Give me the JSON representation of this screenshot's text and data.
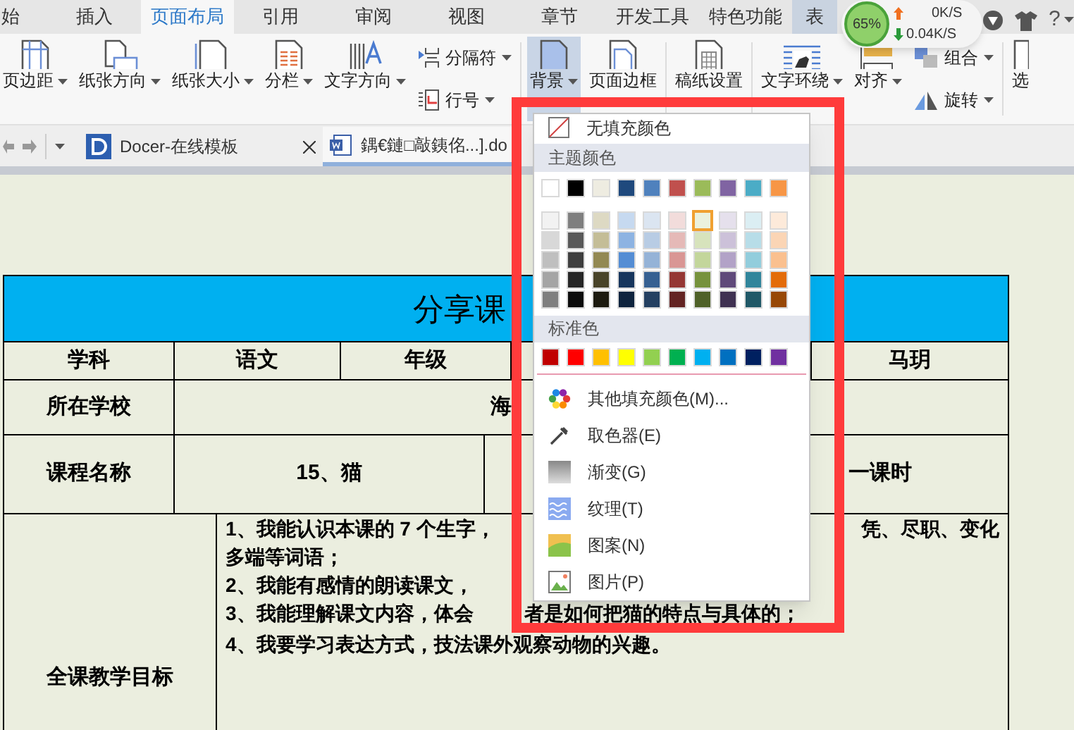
{
  "menu_tabs": [
    {
      "label": "始",
      "selected": false
    },
    {
      "label": "插入",
      "selected": false
    },
    {
      "label": "页面布局",
      "selected": true
    },
    {
      "label": "引用",
      "selected": false
    },
    {
      "label": "审阅",
      "selected": false
    },
    {
      "label": "视图",
      "selected": false
    },
    {
      "label": "章节",
      "selected": false
    },
    {
      "label": "开发工具",
      "selected": false
    },
    {
      "label": "特色功能",
      "selected": false
    },
    {
      "label": "表",
      "selected": false
    }
  ],
  "speed_widget": {
    "percent": "65%",
    "upload": "0K/S",
    "download": "0.04K/S"
  },
  "help": "?",
  "ribbon": [
    {
      "kind": "large",
      "label": "页边距",
      "dropdown": true,
      "selected": false
    },
    {
      "kind": "large",
      "label": "纸张方向",
      "dropdown": true,
      "selected": false
    },
    {
      "kind": "large",
      "label": "纸张大小",
      "dropdown": true,
      "selected": false
    },
    {
      "kind": "large",
      "label": "分栏",
      "dropdown": true,
      "selected": false
    },
    {
      "kind": "large",
      "label": "文字方向",
      "dropdown": true,
      "selected": false
    },
    {
      "kind": "stack",
      "items": [
        {
          "label": "分隔符",
          "dropdown": true,
          "selected": false
        },
        {
          "label": "行号",
          "dropdown": true,
          "selected": false
        }
      ]
    },
    {
      "kind": "separator"
    },
    {
      "kind": "large",
      "label": "背景",
      "dropdown": true,
      "selected": true
    },
    {
      "kind": "large",
      "label": "页面边框",
      "dropdown": false,
      "selected": false
    },
    {
      "kind": "separator"
    },
    {
      "kind": "large",
      "label": "稿纸设置",
      "dropdown": false,
      "selected": false
    },
    {
      "kind": "separator"
    },
    {
      "kind": "large",
      "label": "文字环绕",
      "dropdown": true,
      "selected": false
    },
    {
      "kind": "large",
      "label": "对齐",
      "dropdown": true,
      "selected": false
    },
    {
      "kind": "stack",
      "items": [
        {
          "label": "组合",
          "dropdown": true,
          "selected": false
        },
        {
          "label": "旋转",
          "dropdown": true,
          "selected": false
        }
      ]
    },
    {
      "kind": "separator"
    },
    {
      "kind": "large",
      "label": "选",
      "dropdown": false,
      "selected": false
    }
  ],
  "doc_tabs": [
    {
      "label": "Docer-在线模板",
      "selected": false,
      "closable": true
    },
    {
      "label": "鍝€鏈□敲銕佲...].do",
      "selected": true,
      "closable": false
    }
  ],
  "document": {
    "title": "分享课",
    "row_1": {
      "cells": [
        "学科",
        "语文",
        "年级"
      ],
      "cell_end": "马玥"
    },
    "row_2": {
      "label": "所在学校",
      "value": "海"
    },
    "row_3": {
      "label": "课程名称",
      "value": "15、猫",
      "value_2": "一课时"
    },
    "row_4": {
      "label": "全课教学目标",
      "lines": [
        {
          "kind": "justified",
          "segments": [
            "1、我能认识本课的 7 个生字，",
            "凭、尽职、变化"
          ]
        },
        {
          "kind": "flow",
          "segments": [
            "多端等词语；"
          ]
        },
        {
          "kind": "flow",
          "segments": [
            "2、我能有感情的朗读课文，"
          ]
        },
        {
          "kind": "flow",
          "segments": [
            "3、我能理解课文内容，体会",
            "者是如何把猫的特点与具体的；"
          ]
        },
        {
          "kind": "flow",
          "segments": [
            "4、我要学习表达方式，技法课外观察动物的兴趣。"
          ]
        }
      ]
    }
  },
  "background_menu": {
    "no_fill": "无填充颜色",
    "theme_header": "主题颜色",
    "theme_colors": [
      {
        "color": "#ffffff",
        "selected": false
      },
      {
        "color": "#000000",
        "selected": false
      },
      {
        "color": "#eeece1",
        "selected": false
      },
      {
        "color": "#1f497d",
        "selected": false
      },
      {
        "color": "#4f81bd",
        "selected": false
      },
      {
        "color": "#c0504d",
        "selected": false
      },
      {
        "color": "#9bbb59",
        "selected": false
      },
      {
        "color": "#8064a2",
        "selected": false
      },
      {
        "color": "#4bacc6",
        "selected": false
      },
      {
        "color": "#f79646",
        "selected": false
      }
    ],
    "shade_rows": [
      [
        {
          "color": "#f2f2f2",
          "selected": false
        },
        {
          "color": "#7f7f7f",
          "selected": false
        },
        {
          "color": "#ddd9c3",
          "selected": false
        },
        {
          "color": "#c6d9f0",
          "selected": false
        },
        {
          "color": "#dbe5f1",
          "selected": false
        },
        {
          "color": "#f2dcdb",
          "selected": false
        },
        {
          "color": "#ebf1dd",
          "selected": true
        },
        {
          "color": "#e5e0ec",
          "selected": false
        },
        {
          "color": "#dbeef3",
          "selected": false
        },
        {
          "color": "#fdeada",
          "selected": false
        }
      ],
      [
        {
          "color": "#d8d8d8",
          "selected": false
        },
        {
          "color": "#595959",
          "selected": false
        },
        {
          "color": "#c4bd97",
          "selected": false
        },
        {
          "color": "#8db3e2",
          "selected": false
        },
        {
          "color": "#b8cce4",
          "selected": false
        },
        {
          "color": "#e5b9b7",
          "selected": false
        },
        {
          "color": "#d7e3bc",
          "selected": false
        },
        {
          "color": "#ccc1d9",
          "selected": false
        },
        {
          "color": "#b7dde8",
          "selected": false
        },
        {
          "color": "#fbd5b5",
          "selected": false
        }
      ],
      [
        {
          "color": "#bfbfbf",
          "selected": false
        },
        {
          "color": "#3f3f3f",
          "selected": false
        },
        {
          "color": "#938953",
          "selected": false
        },
        {
          "color": "#548dd4",
          "selected": false
        },
        {
          "color": "#95b3d7",
          "selected": false
        },
        {
          "color": "#d99694",
          "selected": false
        },
        {
          "color": "#c3d69b",
          "selected": false
        },
        {
          "color": "#b2a2c7",
          "selected": false
        },
        {
          "color": "#92cddc",
          "selected": false
        },
        {
          "color": "#fac08f",
          "selected": false
        }
      ],
      [
        {
          "color": "#a5a5a5",
          "selected": false
        },
        {
          "color": "#262626",
          "selected": false
        },
        {
          "color": "#494429",
          "selected": false
        },
        {
          "color": "#17365d",
          "selected": false
        },
        {
          "color": "#366092",
          "selected": false
        },
        {
          "color": "#953734",
          "selected": false
        },
        {
          "color": "#76923c",
          "selected": false
        },
        {
          "color": "#5f497a",
          "selected": false
        },
        {
          "color": "#31859b",
          "selected": false
        },
        {
          "color": "#e36c09",
          "selected": false
        }
      ],
      [
        {
          "color": "#7f7f7f",
          "selected": false
        },
        {
          "color": "#0c0c0c",
          "selected": false
        },
        {
          "color": "#1d1b10",
          "selected": false
        },
        {
          "color": "#0f243e",
          "selected": false
        },
        {
          "color": "#244061",
          "selected": false
        },
        {
          "color": "#632423",
          "selected": false
        },
        {
          "color": "#4f6128",
          "selected": false
        },
        {
          "color": "#3f3151",
          "selected": false
        },
        {
          "color": "#205867",
          "selected": false
        },
        {
          "color": "#974806",
          "selected": false
        }
      ]
    ],
    "standard_header": "标准色",
    "standard_colors": [
      {
        "color": "#c00000",
        "selected": false
      },
      {
        "color": "#ff0000",
        "selected": false
      },
      {
        "color": "#ffc000",
        "selected": false
      },
      {
        "color": "#ffff00",
        "selected": false
      },
      {
        "color": "#92d050",
        "selected": false
      },
      {
        "color": "#00b050",
        "selected": false
      },
      {
        "color": "#00b0f0",
        "selected": false
      },
      {
        "color": "#0070c0",
        "selected": false
      },
      {
        "color": "#002060",
        "selected": false
      },
      {
        "color": "#7030a0",
        "selected": false
      }
    ],
    "items": [
      "其他填充颜色(M)...",
      "取色器(E)",
      "渐变(G)",
      "纹理(T)",
      "图案(N)",
      "图片(P)"
    ]
  }
}
